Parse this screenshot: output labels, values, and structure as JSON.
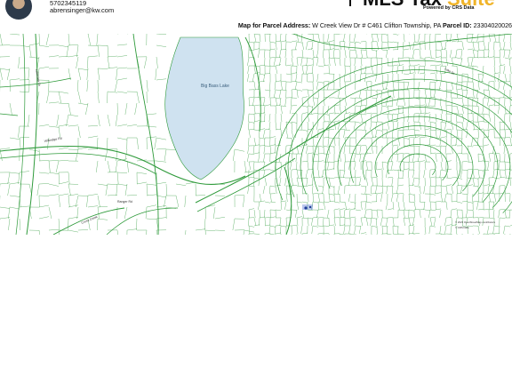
{
  "agent": {
    "phone": "5702345119",
    "email": "abrensinger@kw.com"
  },
  "brand": {
    "name_main": "MLS Tax",
    "name_accent": "Suite",
    "tagline": "Powered by CRS Data",
    "accent_color": "#f0b429"
  },
  "parcel": {
    "map_label": "Map for Parcel Address:",
    "address": "W Creek View Dr # C461 Clifton Township, PA",
    "id_label": "Parcel ID:",
    "id_value": "23304020026"
  },
  "map": {
    "lake_name": "Big Bass Lake",
    "parcel_line_color": "#2e9a3a",
    "water_color": "#cfe2f0",
    "road_labels": [
      "Wilbridge Rd",
      "Lakeview Dr",
      "Cross Creek",
      "Ranger Rd",
      "Lake Dr"
    ],
    "attribution": [
      "© 2023 OpenStreetMap contributors",
      "© CRS Data"
    ]
  }
}
